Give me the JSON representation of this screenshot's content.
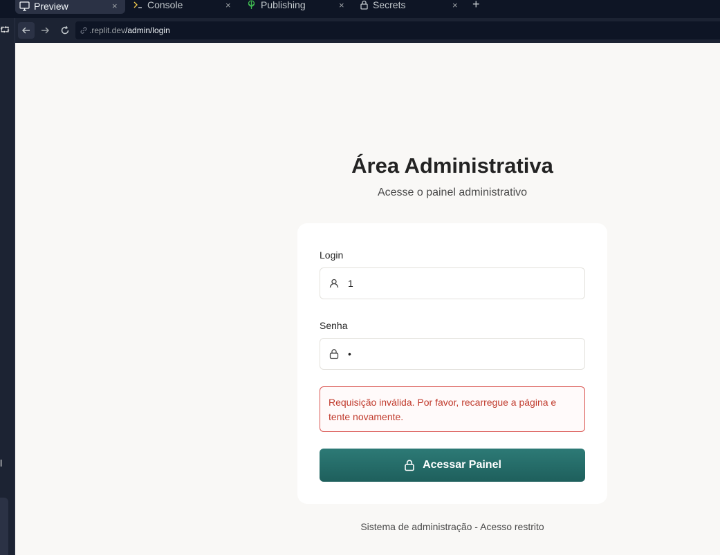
{
  "tabs": [
    {
      "label": "Preview",
      "icon": "monitor-icon"
    },
    {
      "label": "Console",
      "icon": "terminal-icon"
    },
    {
      "label": "Publishing",
      "icon": "publish-icon"
    },
    {
      "label": "Secrets",
      "icon": "lock-icon"
    }
  ],
  "tab_close": "×",
  "tab_add": "+",
  "url": {
    "host": ".replit.dev",
    "path": "/admin/login"
  },
  "left_strip": {
    "top_glyph": "⮔",
    "bottom_glyph": "l"
  },
  "page": {
    "title": "Área Administrativa",
    "subtitle": "Acesse o painel administrativo",
    "login_label": "Login",
    "login_value": "1",
    "password_label": "Senha",
    "password_masked": "•",
    "error_message": "Requisição inválida. Por favor, recarregue a página e tente novamente.",
    "submit_label": "Acessar Painel",
    "footer": "Sistema de administração - Acesso restrito"
  },
  "colors": {
    "accent": "#1e5f5c",
    "error": "#c0392b",
    "page_bg": "#f9f8f6",
    "ide_bg": "#0e1525"
  }
}
